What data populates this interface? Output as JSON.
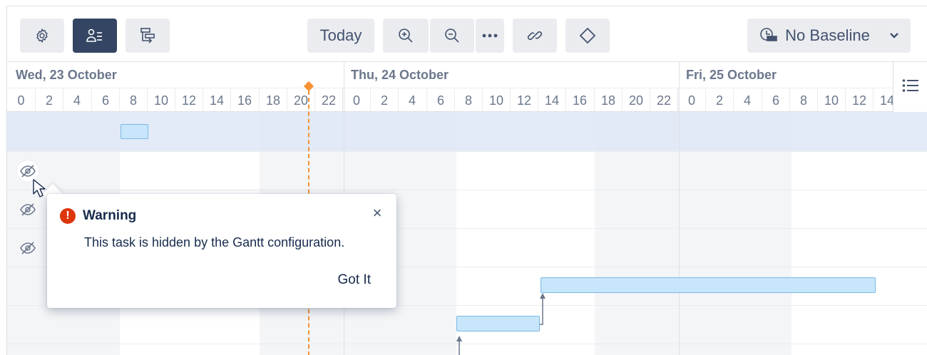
{
  "toolbar": {
    "settings_icon": "gear-icon",
    "resources_icon": "person-list-icon",
    "critical_path_icon": "path-icon",
    "today_label": "Today",
    "zoom_in_icon": "zoom-in-icon",
    "zoom_out_icon": "zoom-out-icon",
    "more_icon": "more-icon",
    "link_icon": "link-icon",
    "milestone_icon": "diamond-icon",
    "baseline_label": "No Baseline",
    "baseline_icon": "baseline-icon",
    "baseline_chevron": "chevron-down-icon"
  },
  "timeline": {
    "days": [
      {
        "label": "Wed, 23 October"
      },
      {
        "label": "Thu, 24 October"
      },
      {
        "label": "Fri, 25 October"
      }
    ],
    "hours": [
      "0",
      "2",
      "4",
      "6",
      "8",
      "10",
      "12",
      "14",
      "16",
      "18",
      "20",
      "22"
    ],
    "last_day_hours": [
      "0",
      "2",
      "4",
      "6",
      "8",
      "10",
      "12",
      "14"
    ]
  },
  "popup": {
    "title": "Warning",
    "message": "This task is hidden by the Gantt configuration.",
    "action": "Got It",
    "close": "×",
    "warn_glyph": "!"
  },
  "colors": {
    "active_button": "#344563",
    "bar_fill": "#c8e6fb",
    "bar_border": "#7ab8e6",
    "today_line": "#f79232",
    "warning": "#de350b"
  }
}
